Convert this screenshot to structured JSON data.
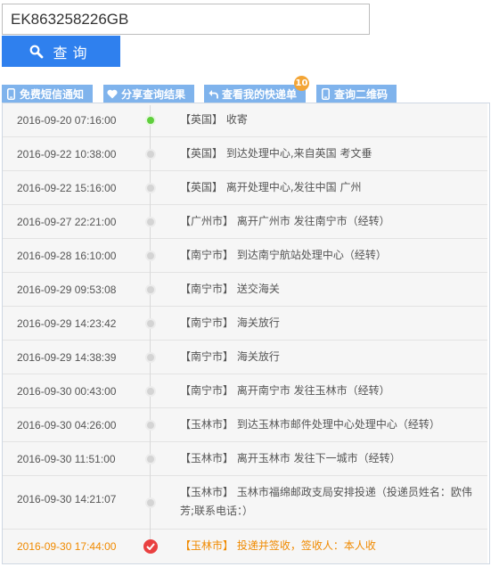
{
  "search": {
    "value": "EK863258226GB",
    "button_label": "查询"
  },
  "toolbar": {
    "items": [
      {
        "label": "免费短信通知",
        "icon": "phone-icon"
      },
      {
        "label": "分享查询结果",
        "icon": "heart-icon"
      },
      {
        "label": "查看我的快递单",
        "icon": "return-arrow-icon",
        "badge": "10"
      },
      {
        "label": "查询二维码",
        "icon": "phone-icon"
      }
    ]
  },
  "colors": {
    "accent": "#2f80ee",
    "toolbar": "#7fb3ec",
    "highlight": "#f08a00",
    "badge": "#f3a536",
    "start_dot": "#5fcf3c",
    "end_mark": "#e94040"
  },
  "timeline": [
    {
      "time": "2016-09-20 07:16:00",
      "desc": "【英国】 收寄"
    },
    {
      "time": "2016-09-22 10:38:00",
      "desc": "【英国】 到达处理中心,来自英国 考文垂"
    },
    {
      "time": "2016-09-22 15:16:00",
      "desc": "【英国】 离开处理中心,发往中国 广州"
    },
    {
      "time": "2016-09-27 22:21:00",
      "desc": "【广州市】 离开广州市 发往南宁市（经转）"
    },
    {
      "time": "2016-09-28 16:10:00",
      "desc": "【南宁市】 到达南宁航站处理中心（经转）"
    },
    {
      "time": "2016-09-29 09:53:08",
      "desc": "【南宁市】 送交海关"
    },
    {
      "time": "2016-09-29 14:23:42",
      "desc": "【南宁市】 海关放行"
    },
    {
      "time": "2016-09-29 14:38:39",
      "desc": "【南宁市】 海关放行"
    },
    {
      "time": "2016-09-30 00:43:00",
      "desc": "【南宁市】 离开南宁市 发往玉林市（经转）"
    },
    {
      "time": "2016-09-30 04:26:00",
      "desc": "【玉林市】 到达玉林市邮件处理中心处理中心（经转）"
    },
    {
      "time": "2016-09-30 11:51:00",
      "desc": "【玉林市】 离开玉林市 发往下一城市（经转）"
    },
    {
      "time": "2016-09-30 14:21:07",
      "desc": "【玉林市】 玉林市福绵邮政支局安排投递（投递员姓名：欧伟芳;联系电话：）"
    },
    {
      "time": "2016-09-30 17:44:00",
      "desc": "【玉林市】 投递并签收，签收人：本人收"
    }
  ]
}
